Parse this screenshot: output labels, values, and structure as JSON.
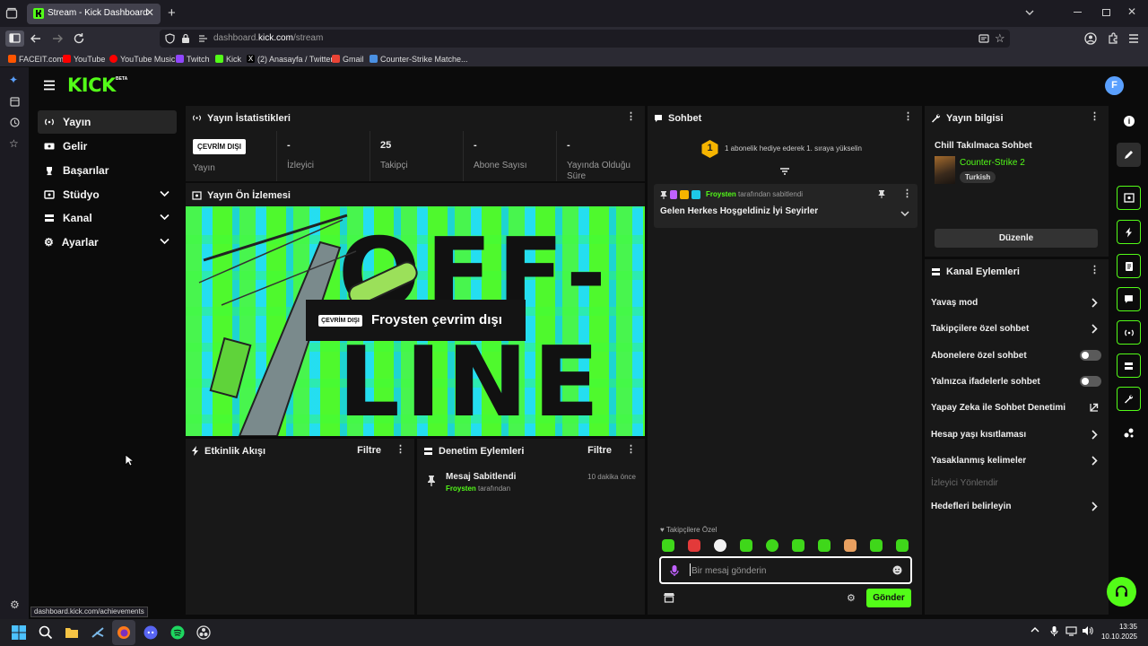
{
  "browser": {
    "tab_title": "Stream - Kick Dashboard",
    "url_prefix": "dashboard.",
    "url_domain": "kick.com",
    "url_path": "/stream",
    "status_url": "dashboard.kick.com/achievements",
    "bookmarks": [
      {
        "label": "FACEIT.com",
        "color": "#ff5500"
      },
      {
        "label": "YouTube",
        "color": "#ff0000"
      },
      {
        "label": "YouTube Music",
        "color": "#ff0000"
      },
      {
        "label": "Twitch",
        "color": "#9146ff"
      },
      {
        "label": "Kick",
        "color": "#53fc18"
      },
      {
        "label": "(2) Anasayfa / Twitter",
        "color": "#ffffff"
      },
      {
        "label": "Gmail",
        "color": "#ea4335"
      },
      {
        "label": "Counter-Strike Matche...",
        "color": "#4a90e2"
      }
    ]
  },
  "kick": {
    "logo": "KICK",
    "logo_badge": "BETA",
    "accent": "#53fc18",
    "nav": [
      {
        "label": "Yayın",
        "icon": "broadcast-icon",
        "active": true
      },
      {
        "label": "Gelir",
        "icon": "money-icon"
      },
      {
        "label": "Başarılar",
        "icon": "trophy-icon"
      },
      {
        "label": "Stüdyo",
        "icon": "studio-icon",
        "expandable": true
      },
      {
        "label": "Kanal",
        "icon": "channel-icon",
        "expandable": true
      },
      {
        "label": "Ayarlar",
        "icon": "gear-icon",
        "expandable": true
      }
    ],
    "stats": {
      "title": "Yayın İstatistikleri",
      "status_badge": "ÇEVRİM DIŞI",
      "status_label": "Yayın",
      "items": [
        {
          "value": "-",
          "label": "İzleyici"
        },
        {
          "value": "25",
          "label": "Takipçi"
        },
        {
          "value": "-",
          "label": "Abone Sayısı"
        },
        {
          "value": "-",
          "label": "Yayında Olduğu Süre"
        }
      ]
    },
    "preview": {
      "title": "Yayın Ön İzlemesi",
      "offline_badge": "ÇEVRİM DIŞI",
      "offline_text": "Froysten çevrim dışı",
      "bg_word_1": "OFF-",
      "bg_word_2": "LINE"
    },
    "activity": {
      "title": "Etkinlik Akışı",
      "filter": "Filtre"
    },
    "moderation": {
      "title": "Denetim Eylemleri",
      "filter": "Filtre",
      "item_title": "Mesaj Sabitlendi",
      "item_user": "Froysten",
      "item_suffix": "tarafından",
      "item_time": "10 dakika önce"
    },
    "chat": {
      "title": "Sohbet",
      "rank_number": "1",
      "rank_text": "1 abonelik hediye ederek 1. sıraya yükselin",
      "pinned_user": "Froysten",
      "pinned_suffix": "tarafından sabitlendi",
      "pinned_message": "Gelen Herkes Hoşgeldiniz İyi Seyirler",
      "followers_only_label": "Takipçilere Özel",
      "input_placeholder": "Bir mesaj gönderin",
      "send_label": "Gönder"
    },
    "stream_info": {
      "title": "Yayın bilgisi",
      "stream_title": "Chill Takılmaca Sohbet",
      "category": "Counter-Strike 2",
      "language": "Turkish",
      "edit_label": "Düzenle"
    },
    "channel_actions": {
      "title": "Kanal Eylemleri",
      "items": [
        {
          "label": "Yavaş mod",
          "control": "chevron"
        },
        {
          "label": "Takipçilere özel sohbet",
          "control": "chevron"
        },
        {
          "label": "Abonelere özel sohbet",
          "control": "toggle",
          "enabled": false
        },
        {
          "label": "Yalnızca ifadelerle sohbet",
          "control": "toggle",
          "enabled": false
        },
        {
          "label": "Yapay Zeka ile Sohbet Denetimi",
          "control": "external"
        },
        {
          "label": "Hesap yaşı kısıtlaması",
          "control": "chevron"
        },
        {
          "label": "Yasaklanmış kelimeler",
          "control": "chevron"
        },
        {
          "label": "İzleyici Yönlendir",
          "control": "disabled"
        },
        {
          "label": "Hedefleri belirleyin",
          "control": "chevron"
        }
      ]
    }
  },
  "taskbar": {
    "time": "13:35",
    "date": "10.10.2025"
  }
}
